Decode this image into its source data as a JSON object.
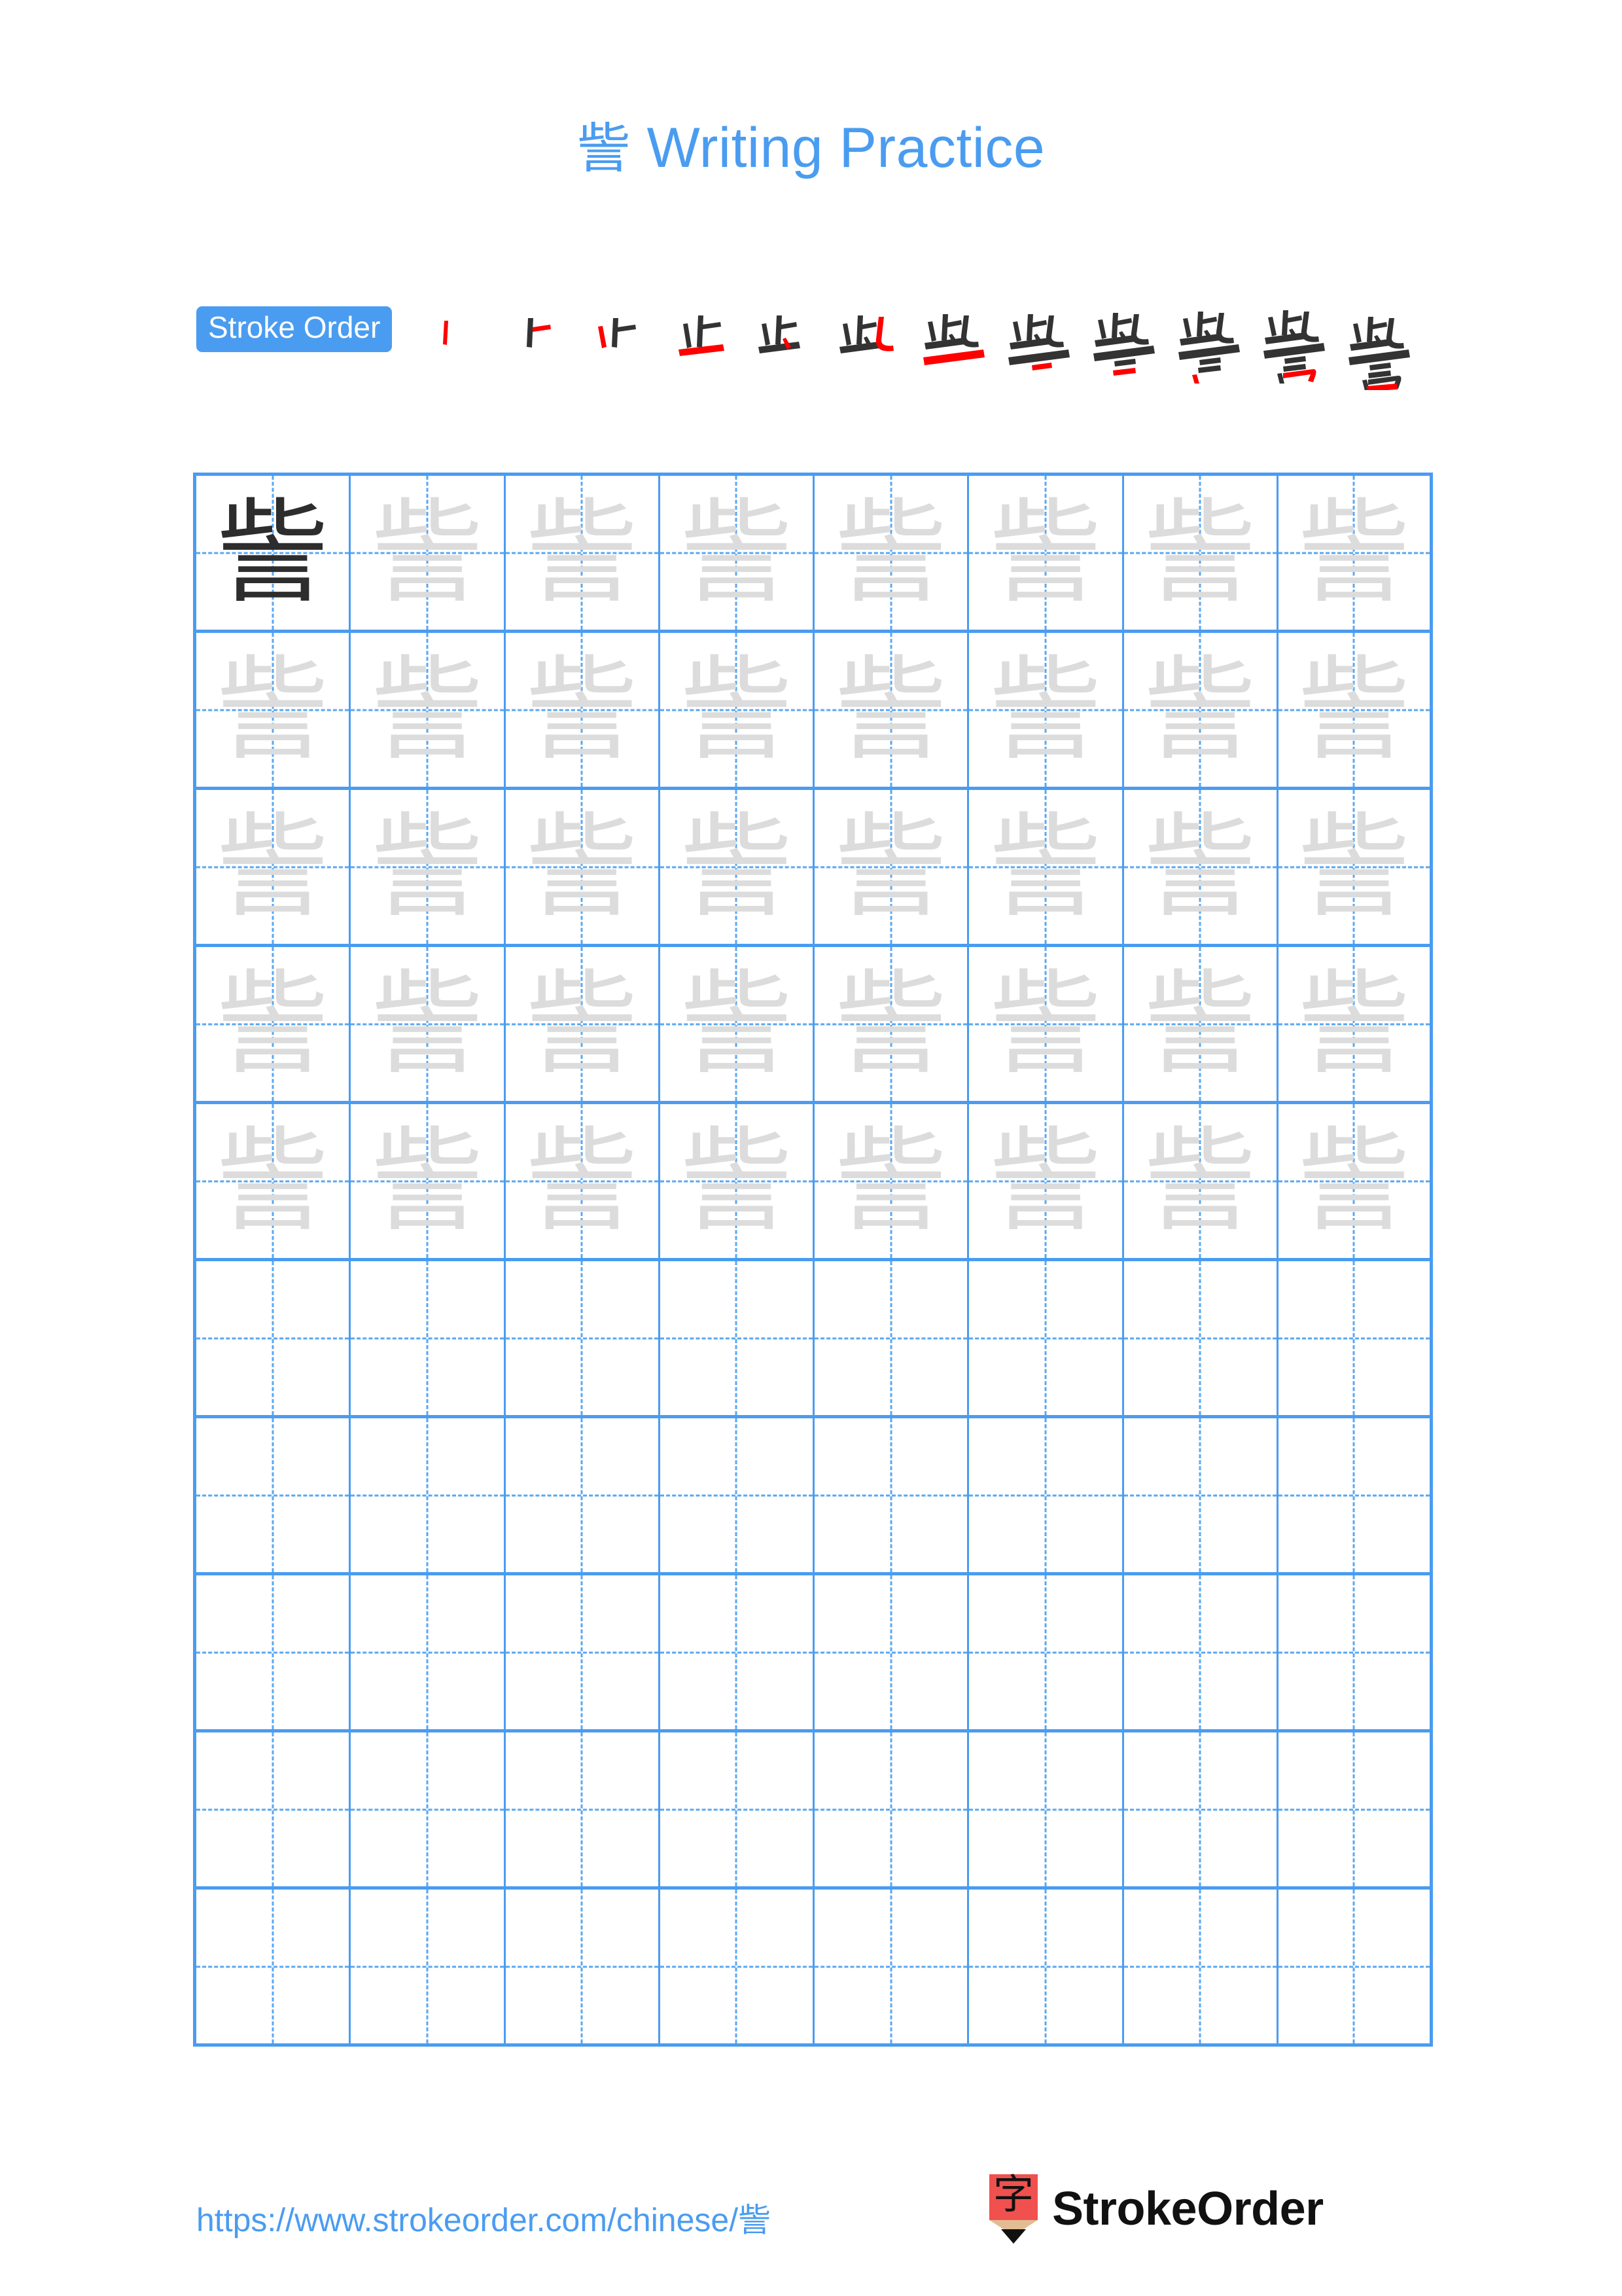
{
  "page": {
    "background_color": "#ffffff",
    "accent_color": "#4a9cf0",
    "grid_line_color": "#4a9cf0",
    "trace_char_color": "#dcdcdc",
    "model_char_color": "#2d2d2d"
  },
  "title": {
    "character": "訾",
    "text": " Writing Practice",
    "full": "訾 Writing Practice"
  },
  "stroke_order": {
    "badge_label": "Stroke Order",
    "total_strokes": 12,
    "steps": [
      {
        "index": 1,
        "glyph": "丨",
        "new_stroke": "vertical"
      },
      {
        "index": 2,
        "glyph": "卜",
        "new_stroke": "horizontal"
      },
      {
        "index": 3,
        "glyph": "⺊",
        "new_stroke": "left-falling"
      },
      {
        "index": 4,
        "glyph": "止",
        "new_stroke": "bottom-horizontal"
      },
      {
        "index": 5,
        "glyph": "此",
        "new_stroke": "short-slash"
      },
      {
        "index": 6,
        "glyph": "此",
        "new_stroke": "vertical-bend"
      },
      {
        "index": 7,
        "glyph": "些",
        "new_stroke": "long-horizontal"
      },
      {
        "index": 8,
        "glyph": "些",
        "new_stroke": "short-horizontal"
      },
      {
        "index": 9,
        "glyph": "訾",
        "new_stroke": "short-horizontal-2"
      },
      {
        "index": 10,
        "glyph": "訾",
        "new_stroke": "short-horizontal-3"
      },
      {
        "index": 11,
        "glyph": "訾",
        "new_stroke": "mouth-left-vertical"
      },
      {
        "index": 12,
        "glyph": "訾",
        "new_stroke": "mouth-close"
      }
    ]
  },
  "practice_grid": {
    "columns": 8,
    "rows": 10,
    "filled_rows": 5,
    "empty_rows": 5,
    "model_cell": {
      "row": 1,
      "column": 1,
      "character": "訾"
    },
    "trace_character": "訾",
    "rows_data": [
      {
        "cells": [
          {
            "character": "訾",
            "style": "dark"
          },
          {
            "character": "訾",
            "style": "light"
          },
          {
            "character": "訾",
            "style": "light"
          },
          {
            "character": "訾",
            "style": "light"
          },
          {
            "character": "訾",
            "style": "light"
          },
          {
            "character": "訾",
            "style": "light"
          },
          {
            "character": "訾",
            "style": "light"
          },
          {
            "character": "訾",
            "style": "light"
          }
        ]
      },
      {
        "cells": [
          {
            "character": "訾",
            "style": "light"
          },
          {
            "character": "訾",
            "style": "light"
          },
          {
            "character": "訾",
            "style": "light"
          },
          {
            "character": "訾",
            "style": "light"
          },
          {
            "character": "訾",
            "style": "light"
          },
          {
            "character": "訾",
            "style": "light"
          },
          {
            "character": "訾",
            "style": "light"
          },
          {
            "character": "訾",
            "style": "light"
          }
        ]
      },
      {
        "cells": [
          {
            "character": "訾",
            "style": "light"
          },
          {
            "character": "訾",
            "style": "light"
          },
          {
            "character": "訾",
            "style": "light"
          },
          {
            "character": "訾",
            "style": "light"
          },
          {
            "character": "訾",
            "style": "light"
          },
          {
            "character": "訾",
            "style": "light"
          },
          {
            "character": "訾",
            "style": "light"
          },
          {
            "character": "訾",
            "style": "light"
          }
        ]
      },
      {
        "cells": [
          {
            "character": "訾",
            "style": "light"
          },
          {
            "character": "訾",
            "style": "light"
          },
          {
            "character": "訾",
            "style": "light"
          },
          {
            "character": "訾",
            "style": "light"
          },
          {
            "character": "訾",
            "style": "light"
          },
          {
            "character": "訾",
            "style": "light"
          },
          {
            "character": "訾",
            "style": "light"
          },
          {
            "character": "訾",
            "style": "light"
          }
        ]
      },
      {
        "cells": [
          {
            "character": "訾",
            "style": "light"
          },
          {
            "character": "訾",
            "style": "light"
          },
          {
            "character": "訾",
            "style": "light"
          },
          {
            "character": "訾",
            "style": "light"
          },
          {
            "character": "訾",
            "style": "light"
          },
          {
            "character": "訾",
            "style": "light"
          },
          {
            "character": "訾",
            "style": "light"
          },
          {
            "character": "訾",
            "style": "light"
          }
        ]
      },
      {
        "cells": [
          {
            "character": "",
            "style": "empty"
          },
          {
            "character": "",
            "style": "empty"
          },
          {
            "character": "",
            "style": "empty"
          },
          {
            "character": "",
            "style": "empty"
          },
          {
            "character": "",
            "style": "empty"
          },
          {
            "character": "",
            "style": "empty"
          },
          {
            "character": "",
            "style": "empty"
          },
          {
            "character": "",
            "style": "empty"
          }
        ]
      },
      {
        "cells": [
          {
            "character": "",
            "style": "empty"
          },
          {
            "character": "",
            "style": "empty"
          },
          {
            "character": "",
            "style": "empty"
          },
          {
            "character": "",
            "style": "empty"
          },
          {
            "character": "",
            "style": "empty"
          },
          {
            "character": "",
            "style": "empty"
          },
          {
            "character": "",
            "style": "empty"
          },
          {
            "character": "",
            "style": "empty"
          }
        ]
      },
      {
        "cells": [
          {
            "character": "",
            "style": "empty"
          },
          {
            "character": "",
            "style": "empty"
          },
          {
            "character": "",
            "style": "empty"
          },
          {
            "character": "",
            "style": "empty"
          },
          {
            "character": "",
            "style": "empty"
          },
          {
            "character": "",
            "style": "empty"
          },
          {
            "character": "",
            "style": "empty"
          },
          {
            "character": "",
            "style": "empty"
          }
        ]
      },
      {
        "cells": [
          {
            "character": "",
            "style": "empty"
          },
          {
            "character": "",
            "style": "empty"
          },
          {
            "character": "",
            "style": "empty"
          },
          {
            "character": "",
            "style": "empty"
          },
          {
            "character": "",
            "style": "empty"
          },
          {
            "character": "",
            "style": "empty"
          },
          {
            "character": "",
            "style": "empty"
          },
          {
            "character": "",
            "style": "empty"
          }
        ]
      },
      {
        "cells": [
          {
            "character": "",
            "style": "empty"
          },
          {
            "character": "",
            "style": "empty"
          },
          {
            "character": "",
            "style": "empty"
          },
          {
            "character": "",
            "style": "empty"
          },
          {
            "character": "",
            "style": "empty"
          },
          {
            "character": "",
            "style": "empty"
          },
          {
            "character": "",
            "style": "empty"
          },
          {
            "character": "",
            "style": "empty"
          }
        ]
      }
    ]
  },
  "footer": {
    "url": "https://www.strokeorder.com/chinese/訾",
    "brand_name": "StrokeOrder",
    "logo": {
      "glyph": "字",
      "body_color": "#f0514e",
      "wood_color": "#e2bc92",
      "tip_color": "#111111"
    }
  }
}
